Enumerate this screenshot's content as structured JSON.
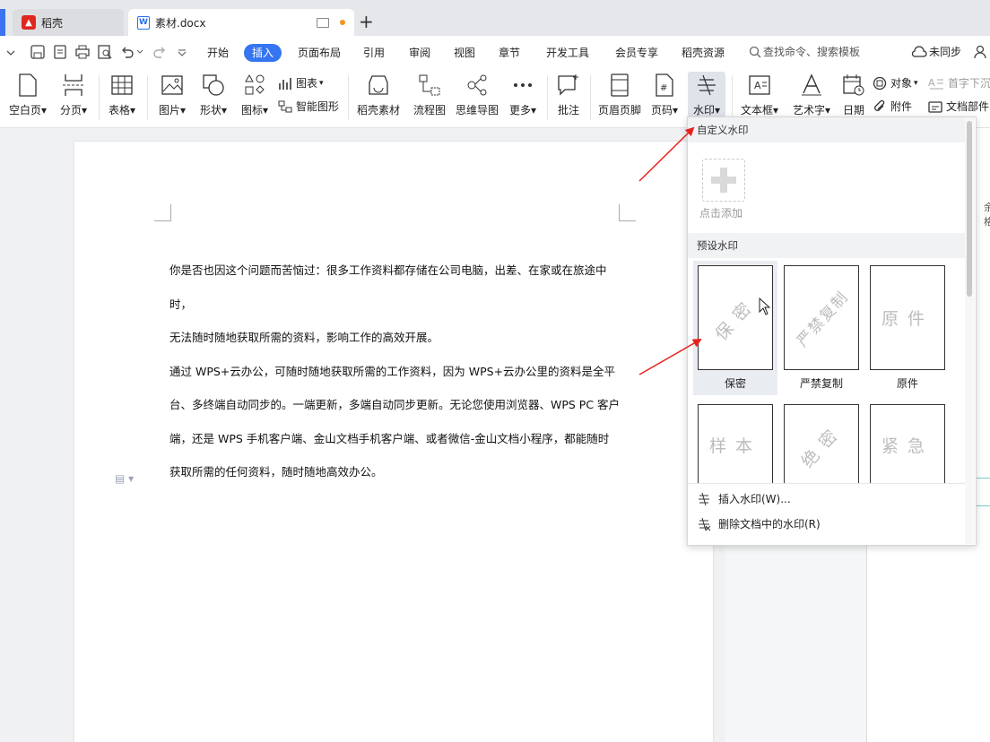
{
  "tabs": [
    {
      "label": "稻壳",
      "icon": "daoke-logo-icon"
    },
    {
      "label": "素材.docx",
      "icon": "wps-writer-doc-icon"
    }
  ],
  "menu": {
    "items": [
      "开始",
      "插入",
      "页面布局",
      "引用",
      "审阅",
      "视图",
      "章节",
      "开发工具",
      "会员专享",
      "稻壳资源"
    ],
    "active": "插入",
    "search_label": "查找命令、搜索模板",
    "sync_label": "未同步"
  },
  "ribbon": {
    "blank_page": "空白页",
    "page_break": "分页",
    "table": "表格",
    "picture": "图片",
    "shape": "形状",
    "icon_lib": "图标",
    "chart": "图表",
    "smart_shape": "智能图形",
    "daoke_material": "稻壳素材",
    "flowchart": "流程图",
    "mindmap": "思维导图",
    "more": "更多",
    "comment": "批注",
    "header_footer": "页眉页脚",
    "page_number": "页码",
    "watermark": "水印",
    "textbox": "文本框",
    "wordart": "艺术字",
    "date": "日期",
    "object": "对象",
    "attachment": "附件",
    "drop_cap": "首字下沉",
    "doc_parts": "文档部件"
  },
  "document": {
    "paragraphs": [
      "你是否也因这个问题而苦恼过：很多工作资料都存储在公司电脑，出差、在家或在旅途中时，",
      "无法随时随地获取所需的资料，影响工作的高效开展。",
      "通过 WPS+云办公，可随时随地获取所需的工作资料，因为 WPS+云办公里的资料是全平",
      "台、多终端自动同步的。一端更新，多端自动同步更新。无论您使用浏览器、WPS PC 客户",
      "端，还是 WPS 手机客户端、金山文档手机客户端、或者微信-金山文档小程序，都能随时",
      "获取所需的任何资料，随时随地高效办公。"
    ]
  },
  "watermark_menu": {
    "custom_header": "自定义水印",
    "add_label": "点击添加",
    "preset_header": "预设水印",
    "presets": [
      {
        "text": "保密",
        "label": "保密",
        "selected": true
      },
      {
        "text": "严禁复制",
        "label": "严禁复制",
        "selected": false
      },
      {
        "text": "原件",
        "label": "原件",
        "selected": false
      },
      {
        "text": "样本",
        "label": "",
        "selected": false
      },
      {
        "text": "绝密",
        "label": "",
        "selected": false
      },
      {
        "text": "紧急",
        "label": "",
        "selected": false
      }
    ],
    "insert_action": "插入水印(W)...",
    "delete_action": "删除文档中的水印(R)"
  },
  "side_panel": {
    "partial_label": "余格"
  },
  "colors": {
    "accent": "#3575f0",
    "annotation_arrow": "#e8221b",
    "watermark_text": "#bcbcbc"
  }
}
